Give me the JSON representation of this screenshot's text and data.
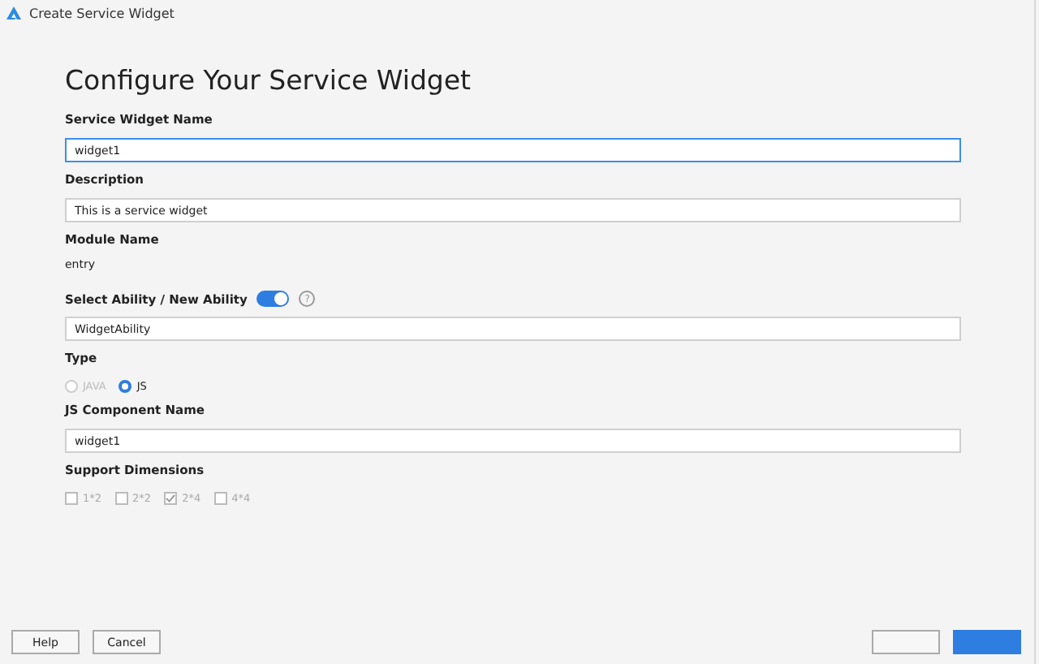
{
  "window": {
    "title": "Create Service Widget"
  },
  "heading": "Configure Your Service Widget",
  "fields": [
    {
      "kind": "text",
      "label": "Service Widget Name",
      "value": "widget1",
      "focused": true
    },
    {
      "kind": "text",
      "label": "Description",
      "value": "This is a service widget",
      "focused": false
    },
    {
      "kind": "static",
      "label": "Module Name",
      "value": "entry"
    },
    {
      "kind": "toggle_text",
      "label": "Select Ability / New Ability",
      "on": true,
      "help": "?",
      "value": "WidgetAbility",
      "focused": false
    },
    {
      "kind": "radio",
      "label": "Type",
      "options": [
        {
          "label": "JAVA",
          "selected": false,
          "disabled": true
        },
        {
          "label": "JS",
          "selected": true,
          "disabled": false
        }
      ]
    },
    {
      "kind": "text",
      "label": "JS Component Name",
      "value": "widget1",
      "focused": false
    },
    {
      "kind": "checks",
      "label": "Support Dimensions",
      "options": [
        {
          "label": "1*2",
          "checked": false
        },
        {
          "label": "2*2",
          "checked": false
        },
        {
          "label": "2*4",
          "checked": true
        },
        {
          "label": "4*4",
          "checked": false
        }
      ]
    }
  ],
  "buttons_left": [
    "Help",
    "Cancel"
  ],
  "buttons_right": [
    {
      "kind": "secondary"
    },
    {
      "kind": "primary"
    }
  ]
}
